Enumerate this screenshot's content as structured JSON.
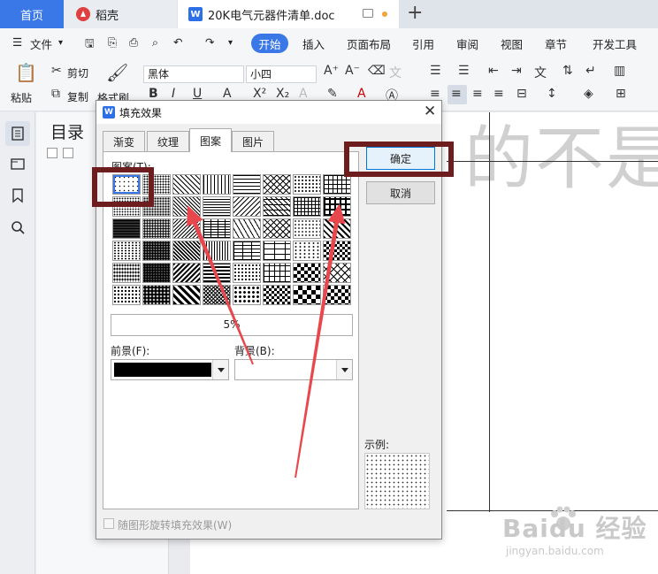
{
  "tabs": {
    "home": "首页",
    "daoke": "稻壳",
    "doc": "20K电气元器件清单.doc",
    "wps_mark": "W"
  },
  "menu": {
    "file": "文件",
    "items": [
      "开始",
      "插入",
      "页面布局",
      "引用",
      "审阅",
      "视图",
      "章节",
      "开发工具"
    ],
    "active": "开始"
  },
  "ribbon": {
    "paste": "粘贴",
    "cut": "剪切",
    "copy": "复制",
    "format_painter": "格式刷",
    "font_name": "黑体",
    "font_size": "小四"
  },
  "toc": {
    "title": "目录"
  },
  "document": {
    "visible_text": "的不是"
  },
  "dialog": {
    "title": "填充效果",
    "tabs": [
      "渐变",
      "纹理",
      "图案",
      "图片"
    ],
    "active_tab": "图案",
    "pattern_label": "图案(T):",
    "selected_pattern": "5%",
    "foreground_label": "前景(F):",
    "background_label": "背景(B):",
    "foreground_color": "#000000",
    "background_color": "#ffffff",
    "ok": "确定",
    "cancel": "取消",
    "sample_label": "示例:",
    "rotate_checkbox": "随图形旋转填充效果(W)",
    "rotate_checked": false
  },
  "colors": {
    "accent": "#3b78e7",
    "annotation": "#6d1d1d",
    "arrow": "#e8484d"
  },
  "watermark": {
    "text": "Baidu 经验",
    "sub": "jingyan.baidu.com"
  }
}
